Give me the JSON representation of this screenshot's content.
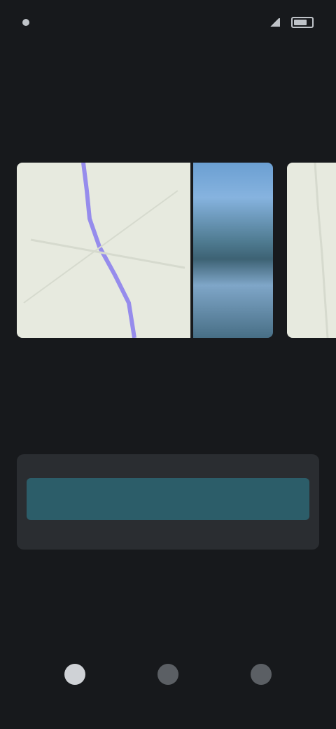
{
  "status_bar": {
    "time": "",
    "right_text": ""
  },
  "section": {
    "title": "",
    "see_all": ""
  },
  "cards": [
    {
      "title": "",
      "meta_left": "",
      "meta_right": ""
    },
    {
      "title": "",
      "meta_left": "",
      "meta_right": ""
    }
  ],
  "banner": {
    "text": "",
    "button_label": ""
  },
  "bottom_nav": [
    {
      "label": "",
      "icon": "home-icon",
      "active": true
    },
    {
      "label": "",
      "icon": "explore-icon",
      "active": false
    },
    {
      "label": "",
      "icon": "profile-icon",
      "active": false
    }
  ],
  "colors": {
    "background": "#17191c",
    "accent": "#3fb7c9",
    "banner_button": "#2c5d69",
    "map_bg": "#e7eadf",
    "route": "#7b6cf0"
  }
}
